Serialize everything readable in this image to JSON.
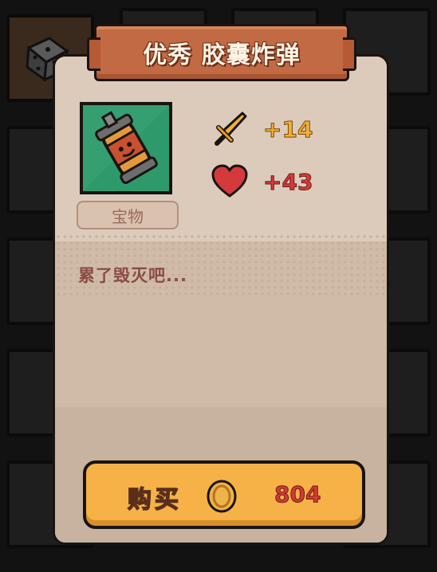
{
  "card": {
    "title": "优秀 胶囊炸弹",
    "category_tag": "宝物",
    "description": "累了毁灭吧...",
    "item_icon": "capsule-bomb-icon",
    "stats": [
      {
        "icon": "sword-icon",
        "value": "+14",
        "color": "#f2b032"
      },
      {
        "icon": "heart-icon",
        "value": "+43",
        "color": "#d33b3b"
      }
    ]
  },
  "buy": {
    "label": "购买",
    "currency_icon": "coin-icon",
    "price": "804"
  },
  "colors": {
    "banner": "#c26a43",
    "button": "#f6b247",
    "item_bg": "#2e9a6c",
    "card_bg": "#d2c0ae"
  }
}
